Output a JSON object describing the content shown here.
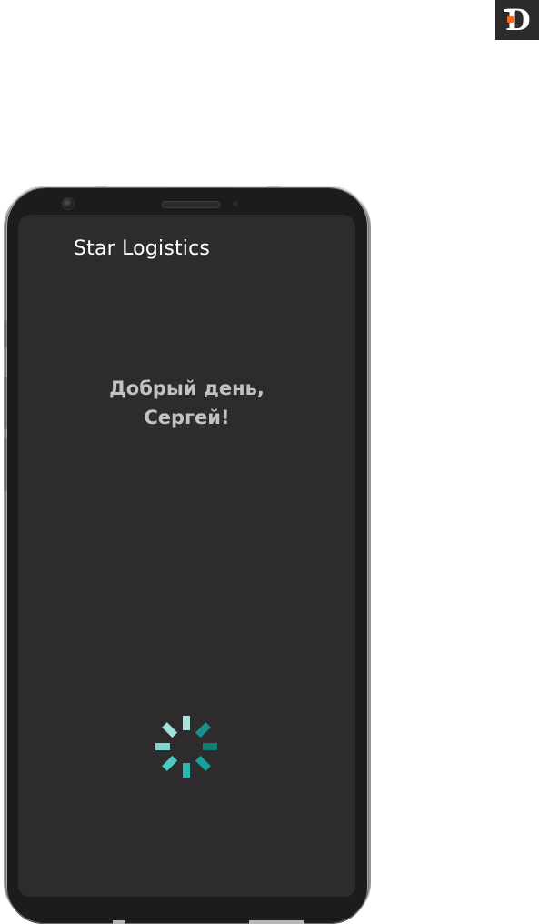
{
  "app": {
    "title": "Star Logistics"
  },
  "greeting": {
    "line1": "Добрый день,",
    "line2": "Сергей!"
  },
  "brand_logo": {
    "letter": "D",
    "icon": "d-logo-icon"
  },
  "spinner": {
    "icon": "loading-spinner-icon",
    "colors": [
      "#a9e4e2",
      "#1b8f8a",
      "#137a74",
      "#12a39b",
      "#2bb7b0",
      "#4fcac3",
      "#7dd6d1",
      "#9ee3df"
    ]
  },
  "colors": {
    "screen_background": "#2d2b2b",
    "title_text": "#ffffff",
    "greeting_text": "#c2c2c2",
    "accent_teal": "#1b8f8a",
    "logo_accent": "#f26b21"
  }
}
